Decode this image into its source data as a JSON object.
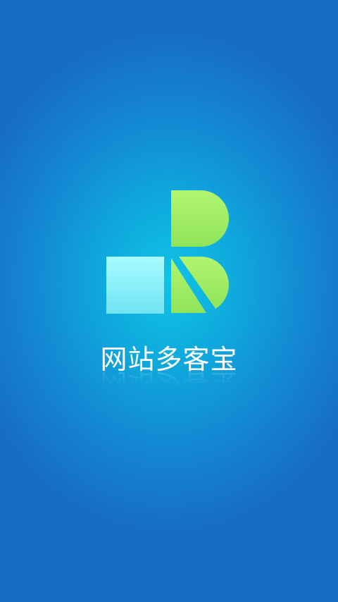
{
  "splash": {
    "app_name": "网站多客宝",
    "background": {
      "center_color": "#10c3e6",
      "edge_color": "#176cc1"
    },
    "logo": {
      "square_color": "#8ef4fb",
      "shape_color": "#9ef06a"
    }
  }
}
